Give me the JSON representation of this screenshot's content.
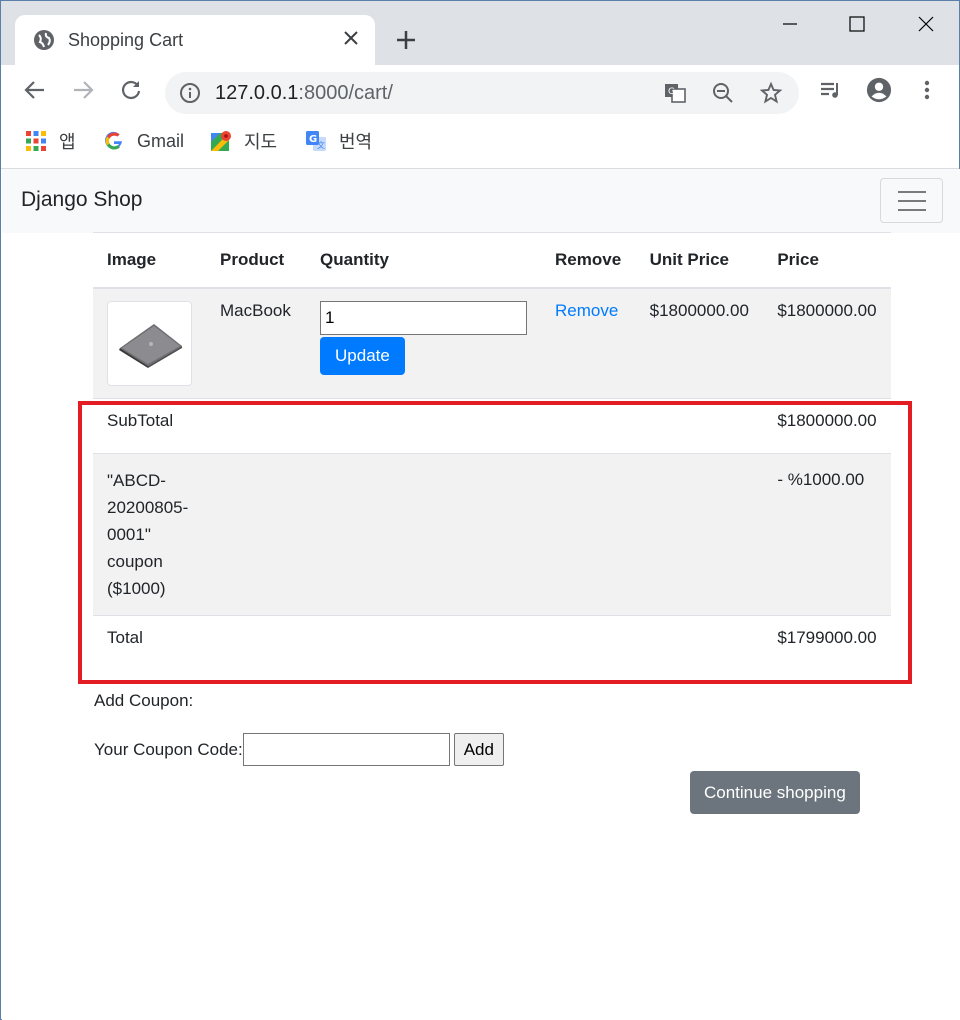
{
  "browser": {
    "tab_title": "Shopping Cart",
    "url_host": "127.0.0.1",
    "url_path": ":8000/cart/",
    "bookmarks": [
      {
        "label": "앱",
        "icon": "apps-grid-icon"
      },
      {
        "label": "Gmail",
        "icon": "google-icon"
      },
      {
        "label": "지도",
        "icon": "maps-icon"
      },
      {
        "label": "번역",
        "icon": "translate-icon"
      }
    ]
  },
  "navbar": {
    "brand": "Django Shop"
  },
  "cart": {
    "headers": [
      "Image",
      "Product",
      "Quantity",
      "Remove",
      "Unit Price",
      "Price"
    ],
    "items": [
      {
        "product": "MacBook",
        "quantity": "1",
        "update_label": "Update",
        "remove_label": "Remove",
        "unit_price": "$1800000.00",
        "price": "$1800000.00"
      }
    ],
    "subtotal_label": "SubTotal",
    "subtotal_value": "$1800000.00",
    "coupon_line1": "\"ABCD-",
    "coupon_line2": "20200805-",
    "coupon_line3": "0001\"",
    "coupon_line4": "coupon",
    "coupon_line5": "($1000)",
    "discount_value": "- %1000.00",
    "total_label": "Total",
    "total_value": "$1799000.00"
  },
  "coupon_form": {
    "heading": "Add Coupon:",
    "code_label": "Your Coupon Code:",
    "code_value": "",
    "add_label": "Add"
  },
  "continue_label": "Continue shopping",
  "colors": {
    "primary": "#007bff",
    "secondary": "#6c757d",
    "highlight": "#e31b23"
  }
}
